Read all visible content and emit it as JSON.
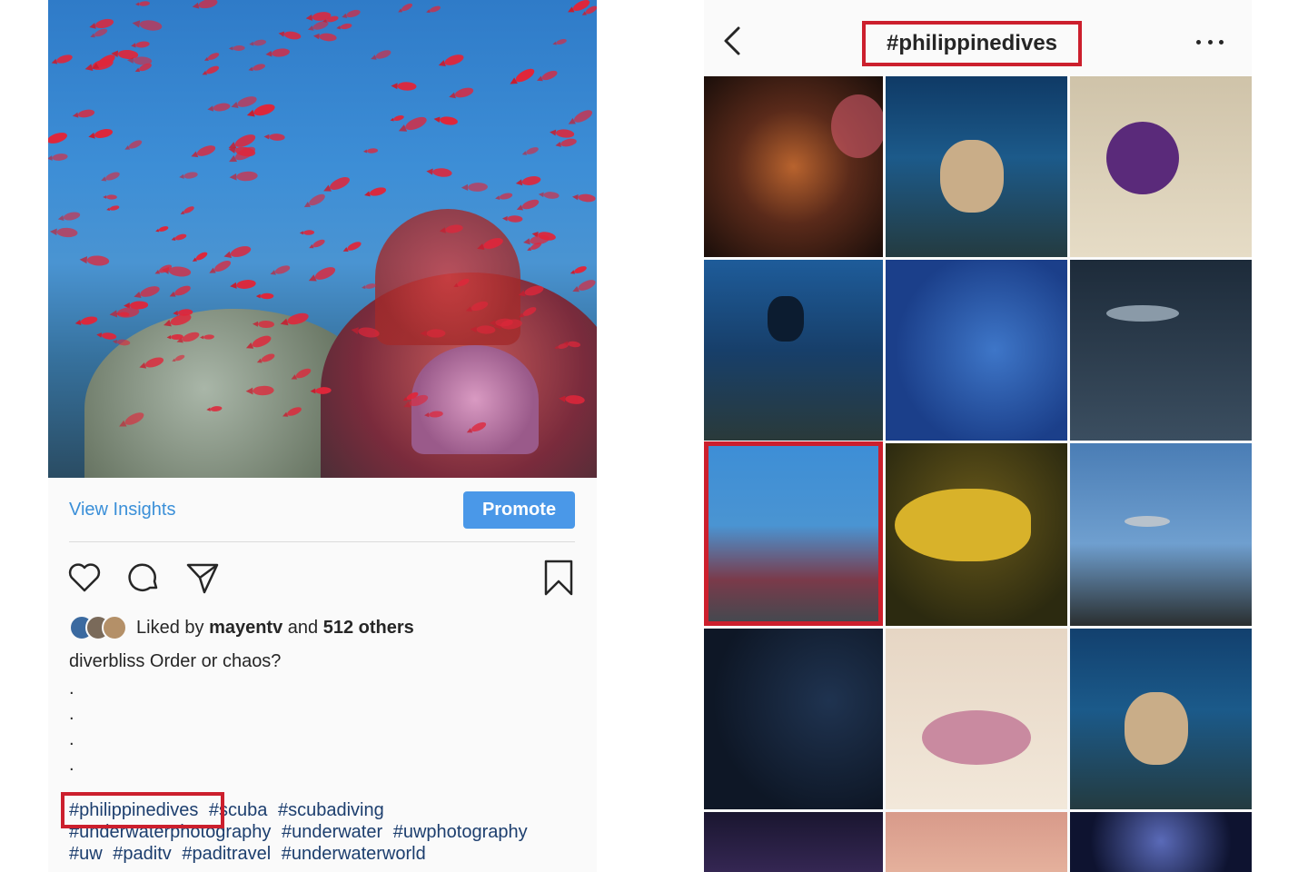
{
  "left_post": {
    "view_insights": "View Insights",
    "promote": "Promote",
    "likes": {
      "prefix": "Liked by",
      "user": "mayentv",
      "middle": "and",
      "others": "512 others"
    },
    "caption": {
      "username": "diverbliss",
      "text": "Order or chaos?"
    },
    "dots": [
      ".",
      ".",
      ".",
      ".",
      "."
    ],
    "hashtags": [
      "#philippinedives",
      "#scuba",
      "#scubadiving",
      "#underwaterphotography",
      "#underwater",
      "#uwphotography",
      "#uw",
      "#paditv",
      "#paditravel",
      "#underwaterworld"
    ]
  },
  "right_page": {
    "title": "#philippinedives",
    "icons": {
      "back": "chevron-left-icon",
      "more": "more-horizontal-icon"
    }
  },
  "colors": {
    "highlight": "#cc1f2d",
    "link_blue": "#3a8fd8",
    "promote_bg": "#4a98e8"
  }
}
